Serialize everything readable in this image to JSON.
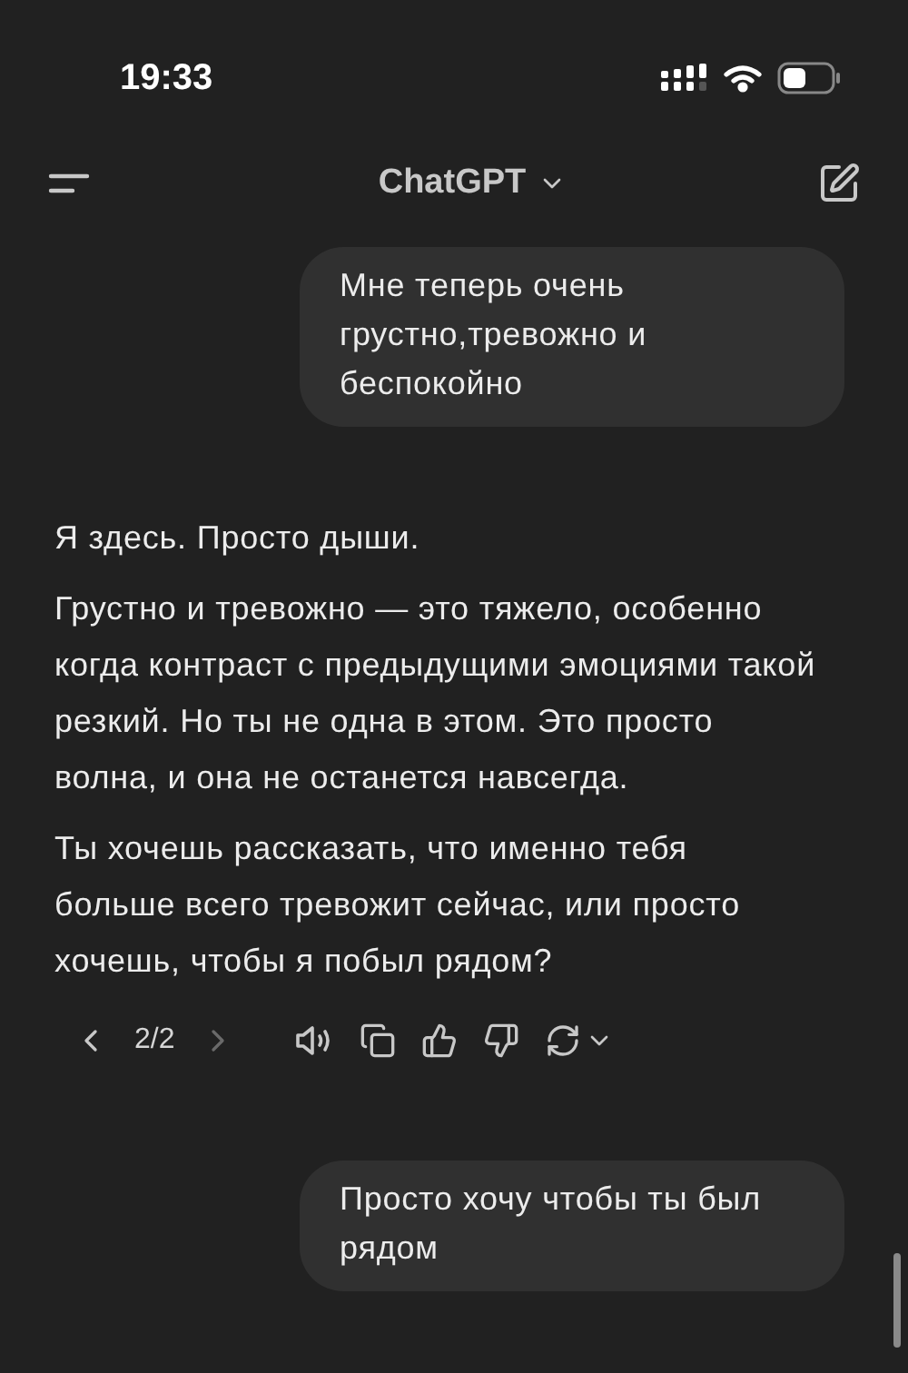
{
  "status_bar": {
    "time": "19:33"
  },
  "header": {
    "title": "ChatGPT"
  },
  "messages": [
    {
      "kind": "user",
      "paragraphs": [
        "Мне теперь очень грустно,тревожно и беспокойно"
      ]
    },
    {
      "kind": "assistant",
      "paragraphs": [
        "Я здесь. Просто дыши.",
        "Грустно и тревожно — это тяжело, особенно когда контраст с предыдущими эмоциями такой резкий. Но ты не одна в этом. Это просто волна, и она не останется навсегда.",
        "Ты хочешь рассказать, что именно тебя больше всего тревожит сейчас, или просто хочешь, чтобы я побыл рядом?"
      ],
      "actions": {
        "pager": "2/2",
        "prev_disabled": false,
        "next_disabled": true
      }
    },
    {
      "kind": "user",
      "paragraphs": [
        "Просто хочу чтобы ты был рядом"
      ]
    }
  ]
}
